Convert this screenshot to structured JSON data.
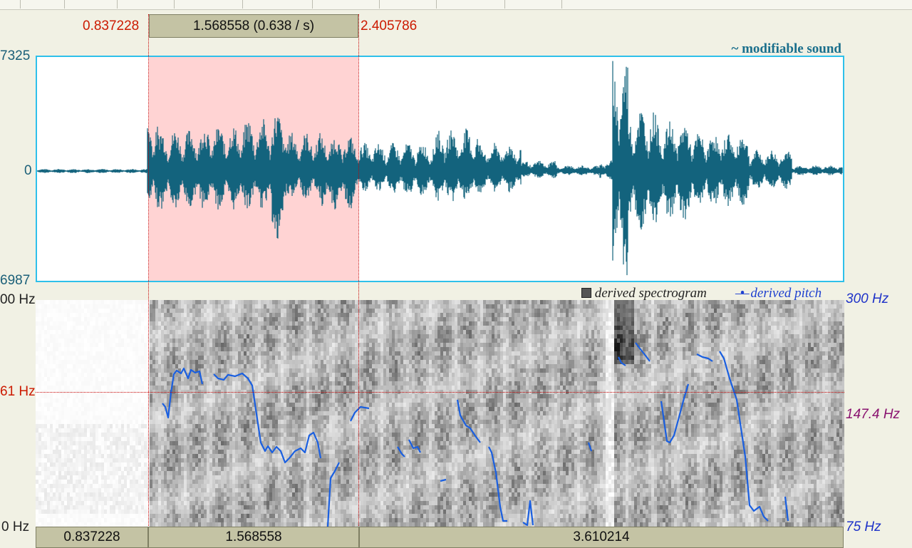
{
  "selection": {
    "start": "0.837228",
    "end": "2.405786",
    "duration_label": "1.568558 (0.638 / s)"
  },
  "waveform": {
    "top_value": "7325",
    "zero_value": "0",
    "bottom_value": "6987",
    "legend": "modifiable sound",
    "legend_icon": "waveform-tilde-icon"
  },
  "spectrogram": {
    "top_freq_label": "00 Hz",
    "bottom_freq_label": "0 Hz",
    "cursor_freq_label": "61 Hz",
    "legend_spectrogram": "derived spectrogram",
    "legend_pitch": "derived pitch",
    "pitch_top": "300 Hz",
    "pitch_mid": "147.4 Hz",
    "pitch_bottom": "75 Hz"
  },
  "time_bar": {
    "left": "0.837228",
    "middle": "1.568558",
    "right": "3.610214"
  },
  "colors": {
    "waveform": "#13637d",
    "selection": "#ffd3d3",
    "panel_border": "#2ec0ea",
    "pitch_line": "#1a5fe0",
    "cursor": "#c80000"
  }
}
